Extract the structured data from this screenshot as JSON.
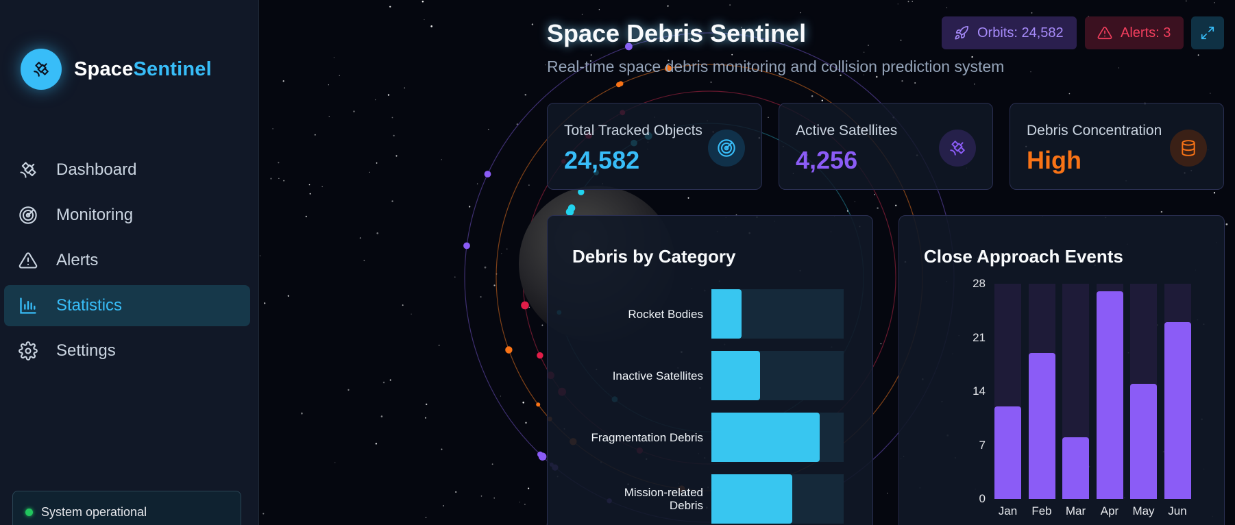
{
  "brand": {
    "name_a": "Space",
    "name_b": "Sentinel",
    "logo_icon": "satellite-icon"
  },
  "nav": [
    {
      "label": "Dashboard",
      "icon": "satellite-icon",
      "active": false
    },
    {
      "label": "Monitoring",
      "icon": "radar-icon",
      "active": false
    },
    {
      "label": "Alerts",
      "icon": "alert-triangle-icon",
      "active": false
    },
    {
      "label": "Statistics",
      "icon": "bar-chart-icon",
      "active": true
    },
    {
      "label": "Settings",
      "icon": "gear-icon",
      "active": false
    }
  ],
  "status": {
    "text": "System operational",
    "color": "#22c55e"
  },
  "header": {
    "title": "Space Debris Sentinel",
    "subtitle": "Real-time space debris monitoring and collision prediction system",
    "orbits_label": "Orbits: 24,582",
    "alerts_label": "Alerts: 3"
  },
  "stats": [
    {
      "label": "Total Tracked Objects",
      "value": "24,582",
      "color": "#38bdf8",
      "icon": "radar-icon"
    },
    {
      "label": "Active Satellites",
      "value": "4,256",
      "color": "#8b5cf6",
      "icon": "satellite-icon"
    },
    {
      "label": "Debris Concentration",
      "value": "High",
      "color": "#f97316",
      "icon": "database-icon"
    }
  ],
  "colors": {
    "accent": "#38bdf8",
    "purple": "#8b5cf6",
    "orange": "#f97316",
    "danger": "#f43f5e"
  },
  "chart_data": [
    {
      "type": "bar",
      "orientation": "horizontal",
      "title": "Debris by Category",
      "categories": [
        "Rocket Bodies",
        "Inactive Satellites",
        "Fragmentation Debris",
        "Mission-related Debris"
      ],
      "values": [
        23,
        37,
        82,
        61
      ],
      "xlim": [
        0,
        100
      ]
    },
    {
      "type": "bar",
      "title": "Close Approach Events",
      "categories": [
        "Jan",
        "Feb",
        "Mar",
        "Apr",
        "May",
        "Jun"
      ],
      "values": [
        12,
        19,
        8,
        27,
        15,
        23
      ],
      "ylim": [
        0,
        28
      ],
      "yticks": [
        0,
        7,
        14,
        21,
        28
      ]
    }
  ]
}
